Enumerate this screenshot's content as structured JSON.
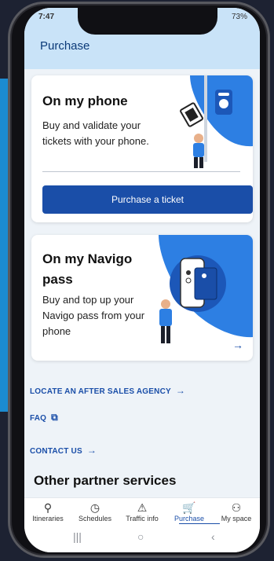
{
  "status": {
    "time": "7:47",
    "battery": "73%"
  },
  "header": {
    "title": "Purchase"
  },
  "cards": [
    {
      "title": "On my phone",
      "text": "Buy and validate your tickets with your phone.",
      "button_label": "Purchase a ticket"
    },
    {
      "title": "On my Navigo pass",
      "text": "Buy and top up your Navigo pass from your phone",
      "arrow": "→"
    }
  ],
  "links": [
    {
      "label": "LOCATE AN AFTER SALES AGENCY",
      "icon": "arrow-right-icon",
      "glyph": "→"
    },
    {
      "label": "FAQ",
      "icon": "external-link-icon",
      "glyph": "⧉"
    },
    {
      "label": "CONTACT US",
      "icon": "arrow-right-icon",
      "glyph": "→"
    }
  ],
  "sections": {
    "other_partners": "Other partner services"
  },
  "tabs": [
    {
      "label": "Itineraries",
      "icon": "route-pin-icon",
      "glyph": "⚲"
    },
    {
      "label": "Schedules",
      "icon": "clock-icon",
      "glyph": "◷"
    },
    {
      "label": "Traffic info",
      "icon": "warning-icon",
      "glyph": "⚠"
    },
    {
      "label": "Purchase",
      "icon": "cart-icon",
      "glyph": "🛒"
    },
    {
      "label": "My space",
      "icon": "person-icon",
      "glyph": "⚇"
    }
  ],
  "active_tab": "Purchase",
  "system_nav": {
    "recent": "|||",
    "home": "○",
    "back": "‹"
  },
  "colors": {
    "accent": "#1a4ea8",
    "header_bg": "#c9e3f8",
    "art_blue": "#2d7fe3"
  }
}
